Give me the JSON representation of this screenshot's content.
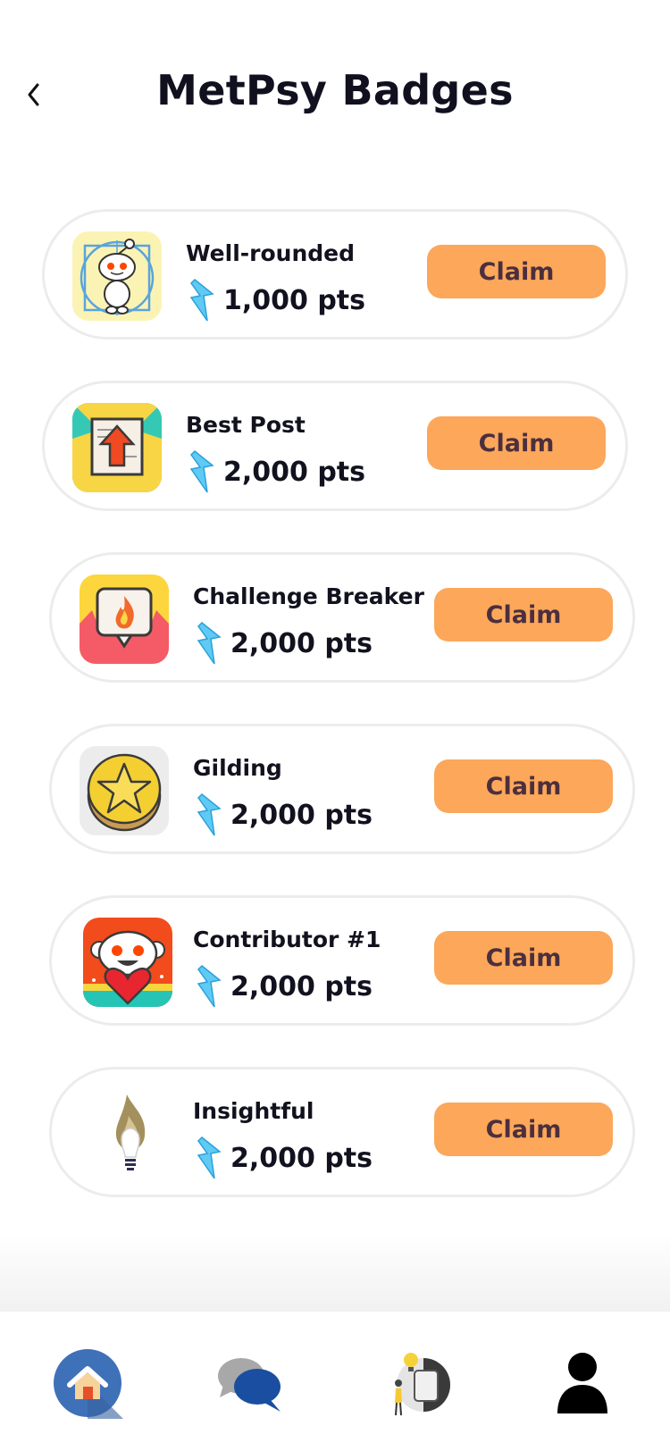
{
  "header": {
    "title": "MetPsy Badges",
    "back_icon": "chevron-left-icon"
  },
  "badges": [
    {
      "name": "Well-rounded",
      "points": "1,000 pts",
      "claim_label": "Claim",
      "icon": "reddit-vitruvian-badge-icon"
    },
    {
      "name": "Best Post",
      "points": "2,000 pts",
      "claim_label": "Claim",
      "icon": "upvote-post-badge-icon"
    },
    {
      "name": "Challenge Breaker",
      "points": "2,000 pts",
      "claim_label": "Claim",
      "icon": "fire-speech-badge-icon"
    },
    {
      "name": "Gilding",
      "points": "2,000 pts",
      "claim_label": "Claim",
      "icon": "gold-star-coin-icon"
    },
    {
      "name": "Contributor #1",
      "points": "2,000 pts",
      "claim_label": "Claim",
      "icon": "reddit-heart-badge-icon"
    },
    {
      "name": "Insightful",
      "points": "2,000 pts",
      "claim_label": "Claim",
      "icon": "lightbulb-flame-icon"
    }
  ],
  "colors": {
    "claim_bg": "#fca75a",
    "claim_text": "#4b2f3e",
    "bolt": "#3fb6ea",
    "home_active": "#3c6db6"
  },
  "bottom_nav": [
    {
      "name": "home",
      "icon": "home-icon",
      "active": true
    },
    {
      "name": "chat",
      "icon": "chat-bubbles-icon",
      "active": false
    },
    {
      "name": "insights",
      "icon": "lightbulb-person-icon",
      "active": false
    },
    {
      "name": "profile",
      "icon": "person-icon",
      "active": false
    }
  ]
}
